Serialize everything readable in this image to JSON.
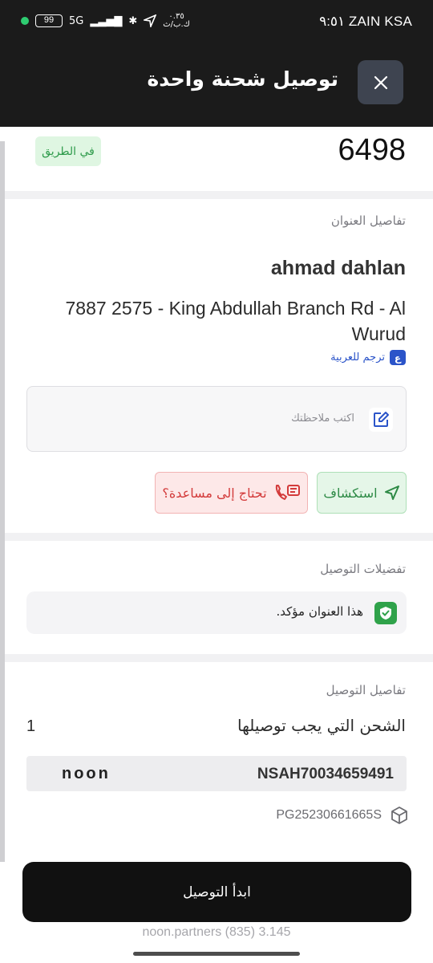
{
  "status_bar": {
    "carrier": "ZAIN KSA",
    "time": "٩:٥١",
    "battery": "99",
    "network": "5G",
    "speed_value": "٠.٣٥",
    "speed_unit": "ك.ب/ث"
  },
  "header": {
    "title": "توصيل شحنة واحدة"
  },
  "summary": {
    "order_number": "6498",
    "status": "في الطريق"
  },
  "address_section": {
    "label": "تفاصيل العنوان",
    "customer_name": "ahmad dahlan",
    "address": "7887 2575 - King Abdullah Branch Rd - Al Wurud",
    "translate_label": "ترجم للعربية",
    "translate_icon_glyph": "ع",
    "note_placeholder": "اكتب ملاحظتك",
    "explore_label": "استكشاف",
    "help_label": "تحتاج إلى مساعدة؟"
  },
  "preferences_section": {
    "label": "تفضيلات التوصيل",
    "verified_text": "هذا العنوان مؤكد."
  },
  "delivery_section": {
    "label": "تفاصيل التوصيل",
    "shipments_label": "الشحن التي يجب توصيلها",
    "shipments_count": "1",
    "awb_number": "NSAH70034659491",
    "brand": "noon",
    "package_id": "PG25230661665S"
  },
  "start_button": {
    "label": "ابدأ التوصيل"
  },
  "footer": {
    "text": "noon.partners (835) 3.145"
  },
  "colors": {
    "header_bg": "#1b1b1b",
    "green": "#2fa24a",
    "red": "#d33a3a",
    "link_blue": "#2b54c9"
  }
}
